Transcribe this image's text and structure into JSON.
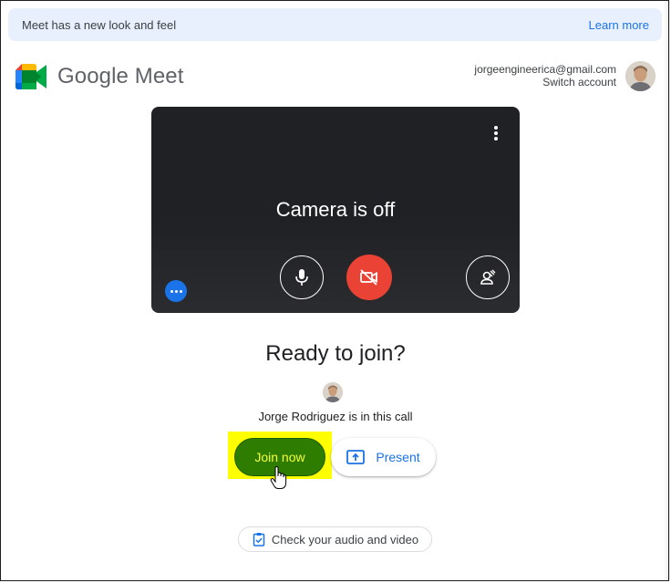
{
  "banner": {
    "text": "Meet has a new look and feel",
    "link": "Learn more"
  },
  "brand": {
    "name": "Google Meet",
    "colors": {
      "green": "#00832d",
      "blue": "#2684fc",
      "yellow": "#ffba00",
      "red": "#ea4335"
    }
  },
  "account": {
    "email": "jorgeengineerica@gmail.com",
    "switch_label": "Switch account"
  },
  "preview": {
    "status": "Camera is off",
    "icons": {
      "options": "more-vert-icon",
      "mic": "mic-icon",
      "camera": "camera-off-icon",
      "effects": "visual-effects-icon",
      "more": "more-horiz-icon"
    }
  },
  "lobby": {
    "heading": "Ready to join?",
    "participant_text": "Jorge Rodriguez is in this call",
    "join_label": "Join now",
    "present_label": "Present",
    "check_label": "Check your audio and video"
  },
  "colors": {
    "accent": "#1a73e8",
    "join_bg": "#2e7d00",
    "join_text": "#f6ff3a",
    "highlight": "#ffff00",
    "camera_off_red": "#ea4335"
  }
}
